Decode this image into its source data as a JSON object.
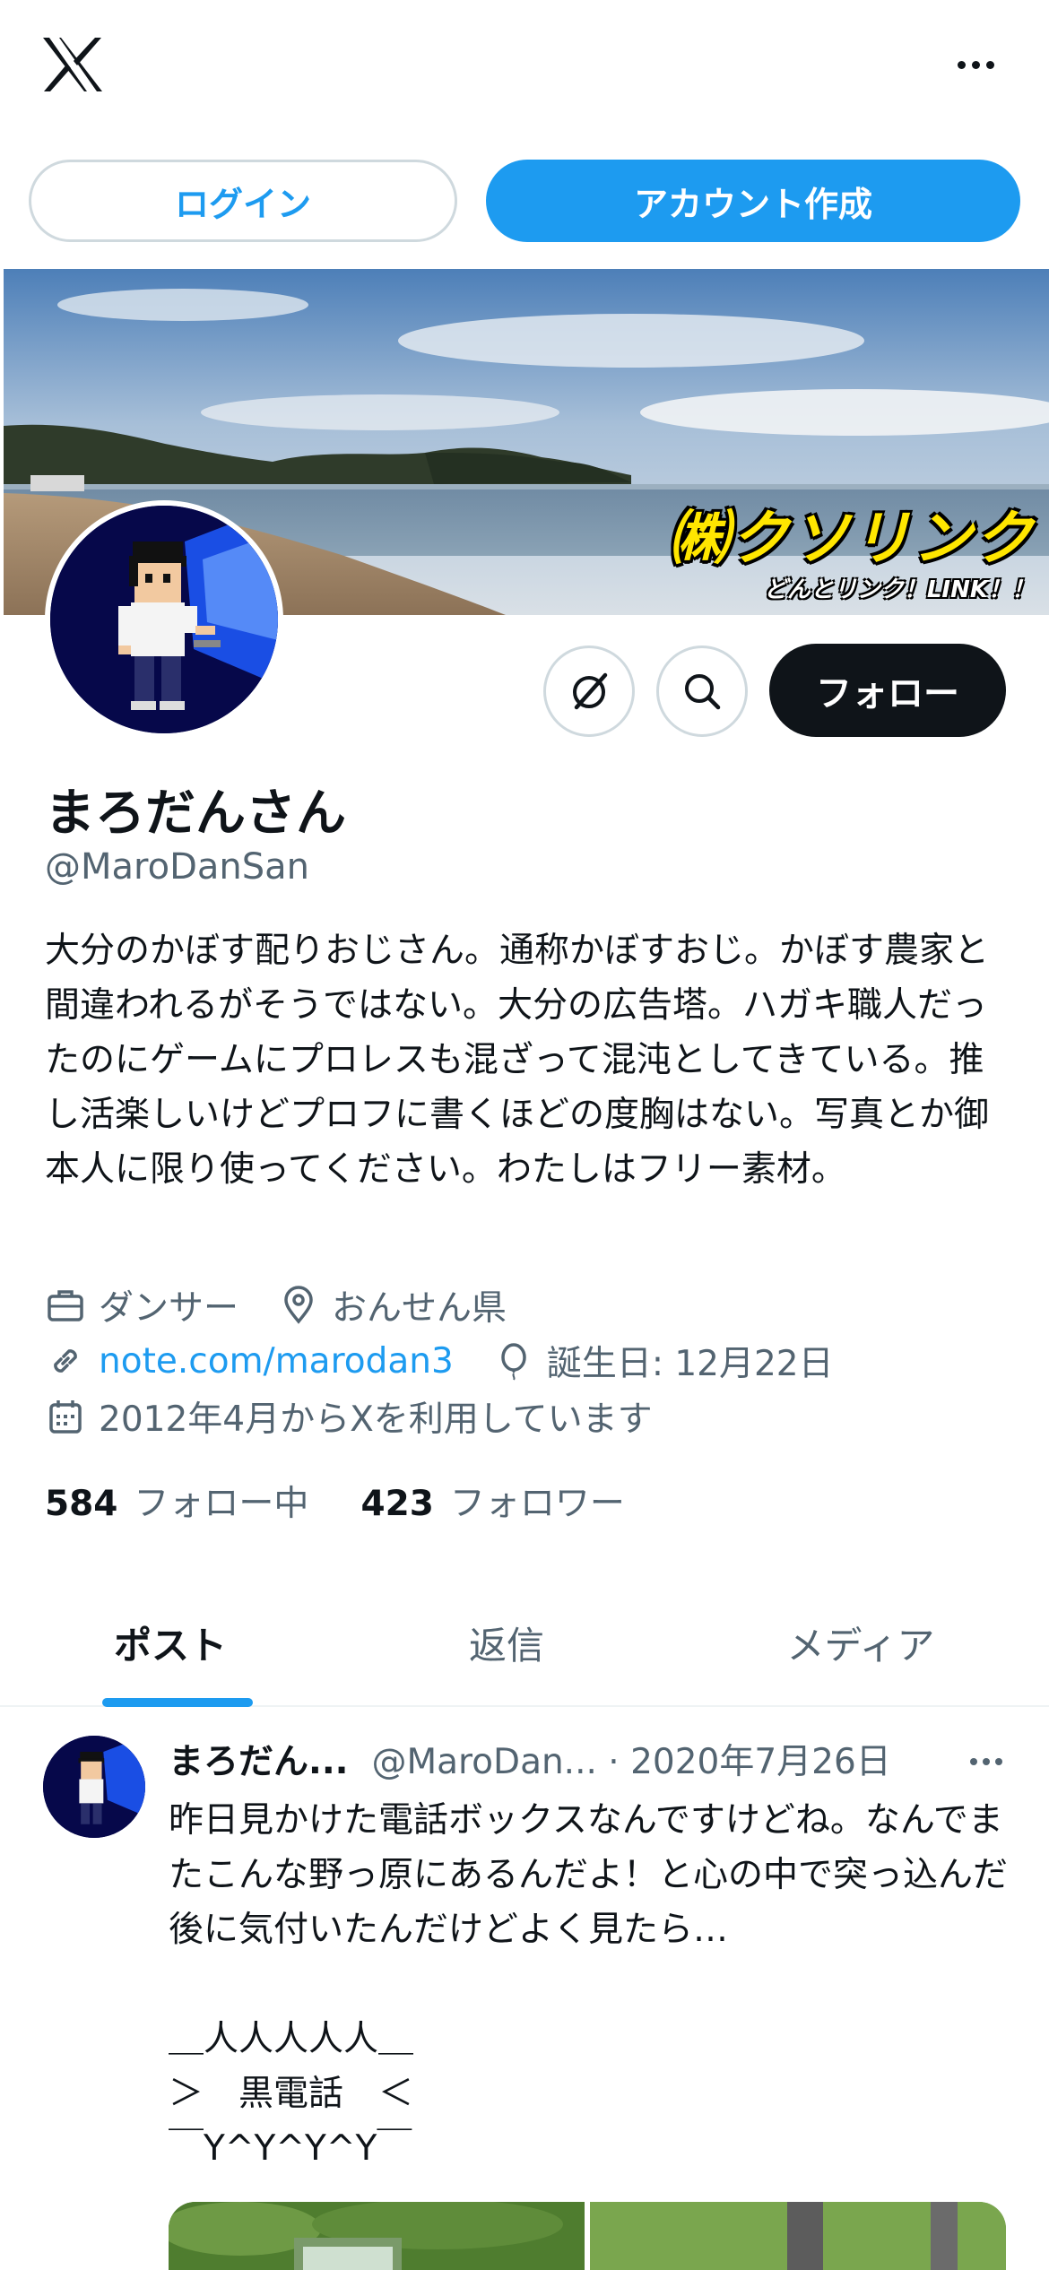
{
  "header": {
    "more_label": ""
  },
  "auth": {
    "login_label": "ログイン",
    "signup_label": "アカウント作成"
  },
  "banner": {
    "logo_main": "㈱クソリンク",
    "logo_sub": "どんとリンク！LINK！！"
  },
  "profile": {
    "display_name": "まろだんさん",
    "handle": "@MaroDanSan",
    "follow_label": "フォロー",
    "bio": "大分のかぼす配りおじさん。通称かぼすおじ。かぼす農家と間違われるがそうではない。大分の広告塔。ハガキ職人だったのにゲームにプロレスも混ざって混沌としてきている。推し活楽しいけどプロフに書くほどの度胸はない。写真とか御本人に限り使ってください。わたしはフリー素材。",
    "profession": "ダンサー",
    "location": "おんせん県",
    "website": "note.com/marodan3",
    "birthday": "誕生日: 12月22日",
    "joined": "2012年4月からXを利用しています",
    "following_count": "584",
    "following_label": "フォロー中",
    "followers_count": "423",
    "followers_label": "フォロワー"
  },
  "tabs": [
    {
      "label": "ポスト",
      "active": true
    },
    {
      "label": "返信",
      "active": false
    },
    {
      "label": "メディア",
      "active": false
    }
  ],
  "post": {
    "name": "まろだん...",
    "meta": "@MaroDan... · 2020年7月26日",
    "text": "昨日見かけた電話ボックスなんですけどね。なんでまたこんな野っ原にあるんだよ！と心の中で突っ込んだ後に気付いたんだけどよく見たら…\n\n＿人人人人人＿\n＞　黒電話　＜\n￣Y^Y^Y^Y￣"
  },
  "colors": {
    "accent": "#1d9bf0",
    "text": "#0f1419",
    "muted": "#536471",
    "border": "#cfd9de"
  }
}
